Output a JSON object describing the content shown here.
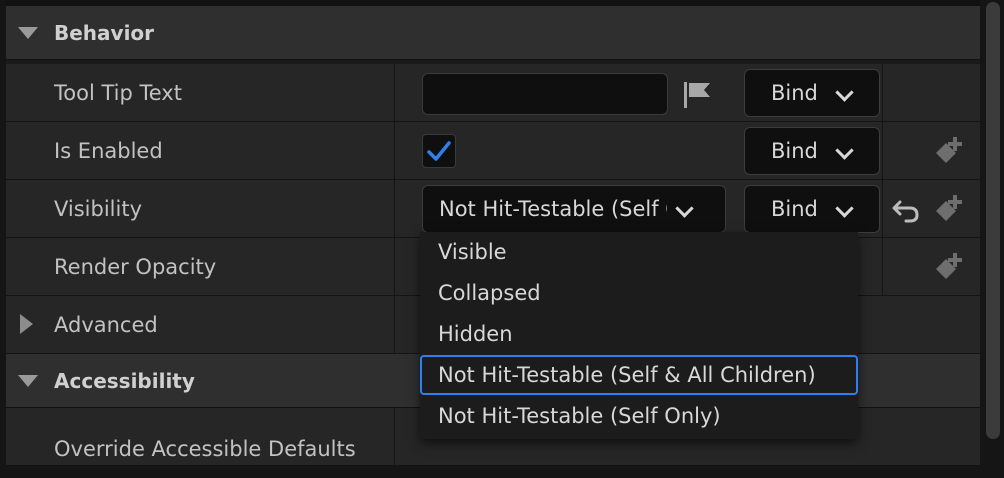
{
  "sections": {
    "behavior": "Behavior",
    "accessibility": "Accessibility"
  },
  "rows": {
    "tooltip": "Tool Tip Text",
    "enabled": "Is Enabled",
    "visibility": "Visibility",
    "opacity": "Render Opacity",
    "advanced": "Advanced",
    "override": "Override Accessible Defaults"
  },
  "controls": {
    "bind_label": "Bind",
    "visibility_value": "Not Hit-Testable (Self Only)",
    "is_enabled_checked": true
  },
  "dropdown": {
    "options": [
      "Visible",
      "Collapsed",
      "Hidden",
      "Not Hit-Testable (Self & All Children)",
      "Not Hit-Testable (Self Only)"
    ],
    "highlighted": "Not Hit-Testable (Self & All Children)"
  },
  "colors": {
    "accent": "#2f7ff0",
    "check": "#2f80ed"
  },
  "icons": [
    "localization-flag-icon",
    "chevron-down-icon",
    "checkmark-icon",
    "reset-arrow-icon",
    "add-binding-icon"
  ]
}
